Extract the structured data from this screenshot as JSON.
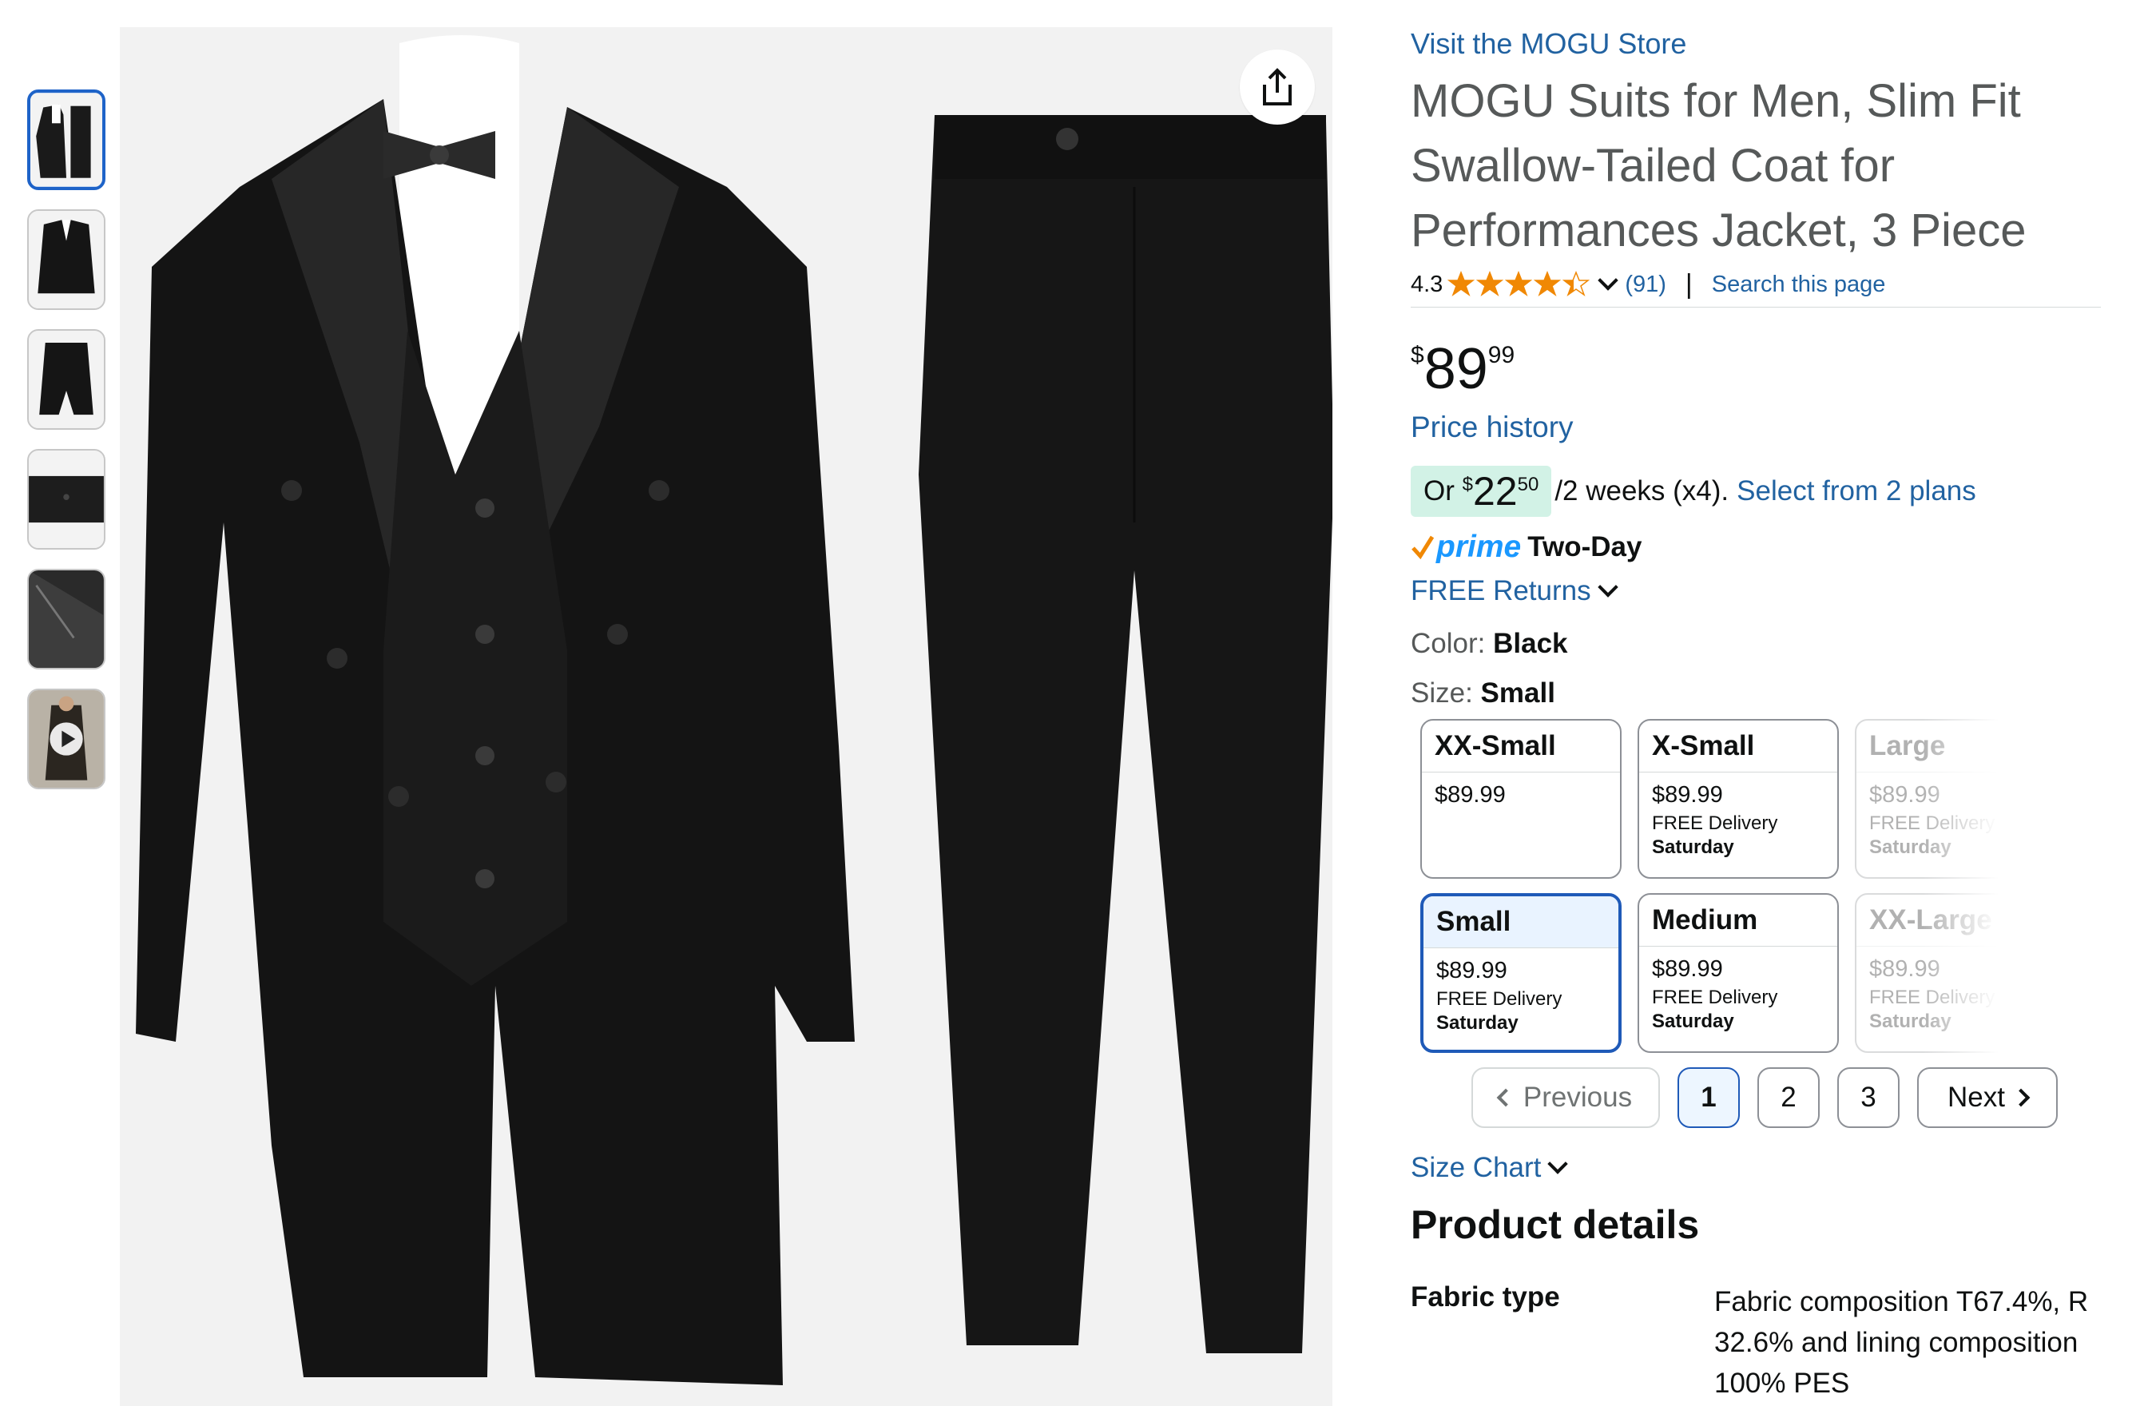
{
  "store": {
    "link_text": "Visit the MOGU Store"
  },
  "product": {
    "title": "MOGU Suits for Men, Slim Fit Swallow-Tailed Coat for Performances Jacket, 3 Piece",
    "rating": "4.3",
    "rating_stars": 4.3,
    "review_count": "(91)",
    "search_page": "Search this page"
  },
  "price": {
    "symbol": "$",
    "whole": "89",
    "fraction": "99",
    "history_link": "Price history"
  },
  "installments": {
    "prefix": "Or ",
    "symbol": "$",
    "whole": "22",
    "fraction": "50",
    "suffix": "/2 weeks (x4).",
    "link": "Select from 2 plans"
  },
  "delivery": {
    "prime": "prime",
    "speed": "Two-Day",
    "returns": "FREE Returns"
  },
  "variations": {
    "color_label": "Color:",
    "color_value": "Black",
    "size_label": "Size:",
    "size_value": "Small",
    "tiles": [
      {
        "name": "XX-Small",
        "price": "$89.99",
        "delivery": "",
        "day": ""
      },
      {
        "name": "X-Small",
        "price": "$89.99",
        "delivery": "FREE Delivery",
        "day": "Saturday"
      },
      {
        "name": "Large",
        "price": "$89.99",
        "delivery": "FREE Delivery",
        "day": "Saturday"
      },
      {
        "name": "Small",
        "price": "$89.99",
        "delivery": "FREE Delivery",
        "day": "Saturday"
      },
      {
        "name": "Medium",
        "price": "$89.99",
        "delivery": "FREE Delivery",
        "day": "Saturday"
      },
      {
        "name": "XX-Large",
        "price": "$89.99",
        "delivery": "FREE Delivery",
        "day": "Saturday"
      }
    ]
  },
  "pagination": {
    "previous": "Previous",
    "pages": [
      "1",
      "2",
      "3"
    ],
    "current": "1",
    "next": "Next"
  },
  "size_chart": "Size Chart",
  "details": {
    "heading": "Product details",
    "rows": [
      {
        "key": "Fabric type",
        "value": "Fabric composition T67.4%, R 32.6% and lining composition 100% PES"
      }
    ]
  },
  "colors": {
    "link": "#2162a1",
    "title": "#565959",
    "star": "#f08804",
    "prime": "#1a98ff",
    "installment_bg": "#d2f2e6",
    "selected_border": "#1f5ab8",
    "suit": "#141414",
    "image_bg": "#f2f2f2"
  },
  "icons": {
    "share": "share-icon",
    "play": "play-icon",
    "chevron": "chevron-down-icon",
    "prime_check": "prime-check-icon"
  }
}
